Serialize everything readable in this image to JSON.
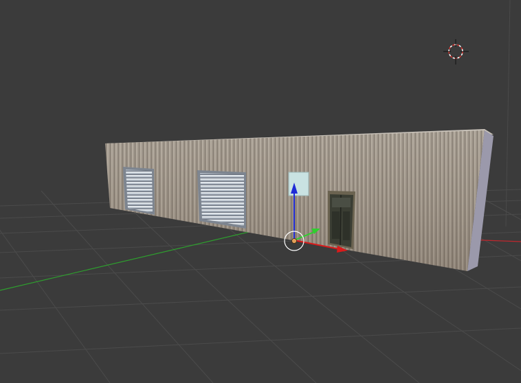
{
  "viewport": {
    "background": "#3b3b3b",
    "grid_color": "#4a4a4a",
    "x_axis_color": "#c0272d",
    "y_axis_color": "#2ea02e"
  },
  "scene": {
    "object": "warehouse-building",
    "wall_color": "#a9a39a",
    "side_wall_color": "#9c9aac",
    "roll_door_color": "#b9c2cc",
    "door_color": "#3a3d33",
    "sign_color": "#c9e2e2"
  },
  "gizmo": {
    "z_axis_color": "#1f2bd6",
    "x_axis_color": "#d81b1b",
    "y_axis_color": "#2fcf2f",
    "origin_color": "#e3a25a"
  },
  "cursor_3d": {
    "color_a": "#d8342f",
    "color_b": "#ffffff"
  }
}
